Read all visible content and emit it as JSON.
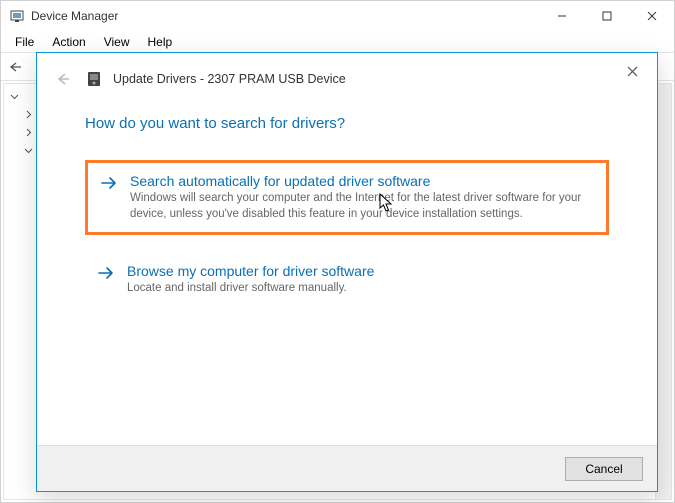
{
  "main": {
    "title": "Device Manager",
    "menu": {
      "file": "File",
      "action": "Action",
      "view": "View",
      "help": "Help"
    }
  },
  "dialog": {
    "header_title": "Update Drivers - 2307 PRAM USB Device",
    "prompt": "How do you want to search for drivers?",
    "option1_title": "Search automatically for updated driver software",
    "option1_desc": "Windows will search your computer and the Internet for the latest driver software for your device, unless you've disabled this feature in your device installation settings.",
    "option2_title": "Browse my computer for driver software",
    "option2_desc": "Locate and install driver software manually.",
    "cancel": "Cancel"
  }
}
